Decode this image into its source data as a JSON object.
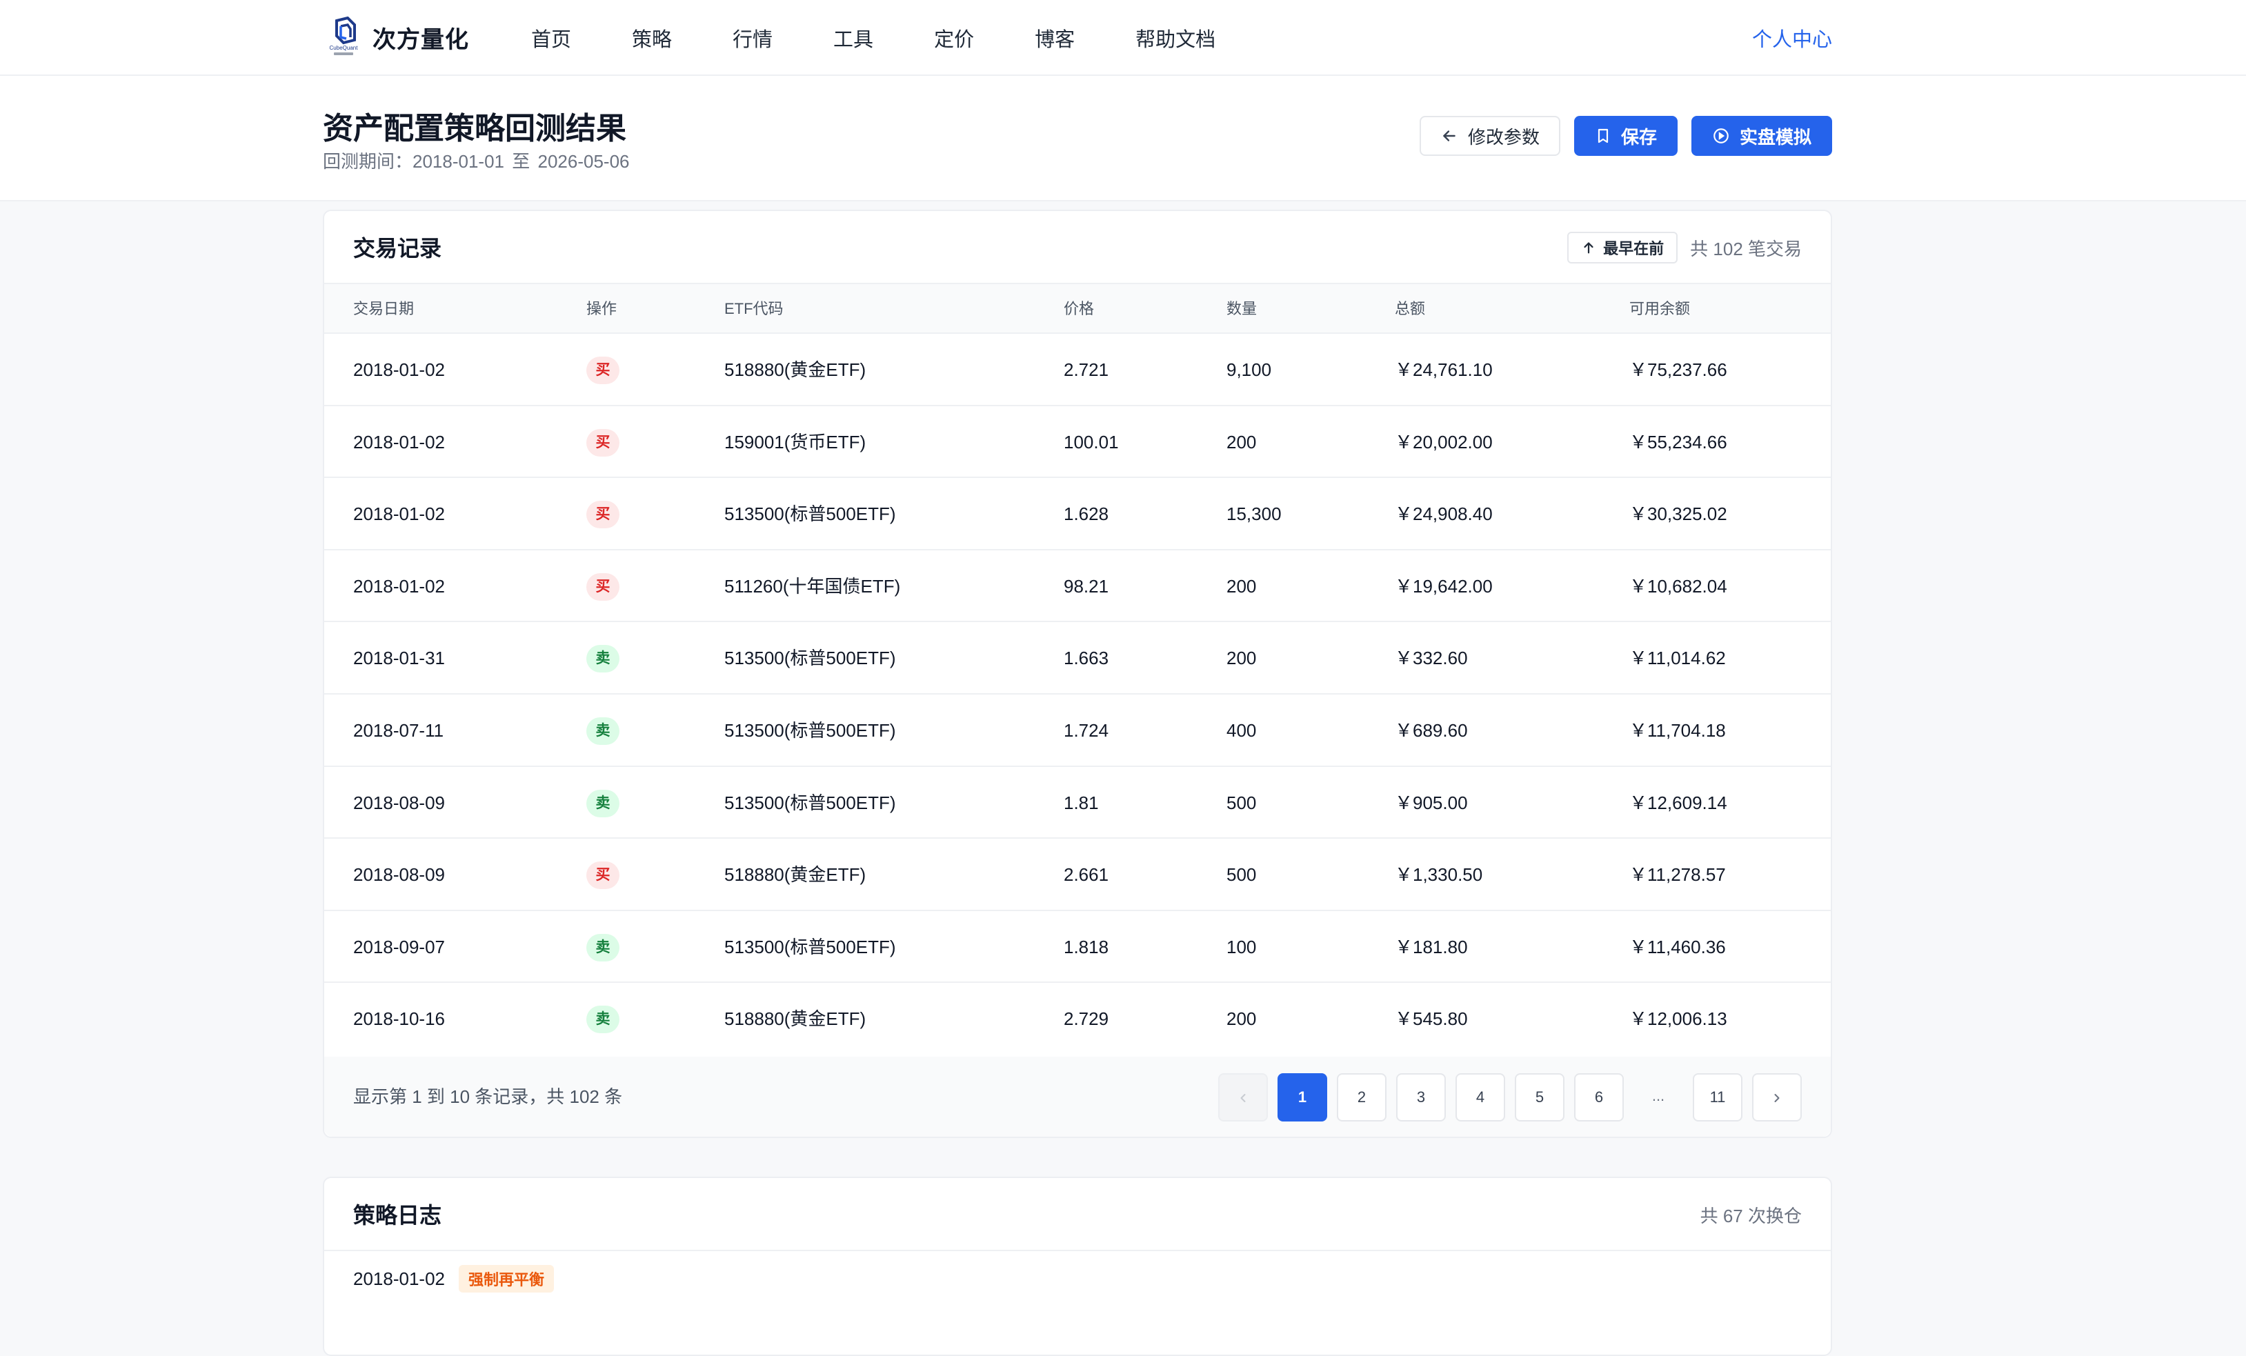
{
  "nav": {
    "brand_name": "次方量化",
    "logo_text": "CubeQuant",
    "items": [
      "首页",
      "策略",
      "行情",
      "工具",
      "定价",
      "博客",
      "帮助文档"
    ],
    "user_center": "个人中心"
  },
  "header": {
    "title": "资产配置策略回测结果",
    "period_label": "回测期间：",
    "period_start": "2018-01-01",
    "period_sep": "至",
    "period_end": "2026-05-06",
    "actions": {
      "edit_params": "修改参数",
      "save": "保存",
      "live_sim": "实盘模拟"
    }
  },
  "trades": {
    "title": "交易记录",
    "sort_label": "最早在前",
    "total_text": "共 102 笔交易",
    "columns": [
      "交易日期",
      "操作",
      "ETF代码",
      "价格",
      "数量",
      "总额",
      "可用余额"
    ],
    "rows": [
      {
        "date": "2018-01-02",
        "op": "买",
        "side": "buy",
        "etf": "518880(黄金ETF)",
        "price": "2.721",
        "qty": "9,100",
        "amount": "￥24,761.10",
        "balance": "￥75,237.66"
      },
      {
        "date": "2018-01-02",
        "op": "买",
        "side": "buy",
        "etf": "159001(货币ETF)",
        "price": "100.01",
        "qty": "200",
        "amount": "￥20,002.00",
        "balance": "￥55,234.66"
      },
      {
        "date": "2018-01-02",
        "op": "买",
        "side": "buy",
        "etf": "513500(标普500ETF)",
        "price": "1.628",
        "qty": "15,300",
        "amount": "￥24,908.40",
        "balance": "￥30,325.02"
      },
      {
        "date": "2018-01-02",
        "op": "买",
        "side": "buy",
        "etf": "511260(十年国债ETF)",
        "price": "98.21",
        "qty": "200",
        "amount": "￥19,642.00",
        "balance": "￥10,682.04"
      },
      {
        "date": "2018-01-31",
        "op": "卖",
        "side": "sell",
        "etf": "513500(标普500ETF)",
        "price": "1.663",
        "qty": "200",
        "amount": "￥332.60",
        "balance": "￥11,014.62"
      },
      {
        "date": "2018-07-11",
        "op": "卖",
        "side": "sell",
        "etf": "513500(标普500ETF)",
        "price": "1.724",
        "qty": "400",
        "amount": "￥689.60",
        "balance": "￥11,704.18"
      },
      {
        "date": "2018-08-09",
        "op": "卖",
        "side": "sell",
        "etf": "513500(标普500ETF)",
        "price": "1.81",
        "qty": "500",
        "amount": "￥905.00",
        "balance": "￥12,609.14"
      },
      {
        "date": "2018-08-09",
        "op": "买",
        "side": "buy",
        "etf": "518880(黄金ETF)",
        "price": "2.661",
        "qty": "500",
        "amount": "￥1,330.50",
        "balance": "￥11,278.57"
      },
      {
        "date": "2018-09-07",
        "op": "卖",
        "side": "sell",
        "etf": "513500(标普500ETF)",
        "price": "1.818",
        "qty": "100",
        "amount": "￥181.80",
        "balance": "￥11,460.36"
      },
      {
        "date": "2018-10-16",
        "op": "卖",
        "side": "sell",
        "etf": "518880(黄金ETF)",
        "price": "2.729",
        "qty": "200",
        "amount": "￥545.80",
        "balance": "￥12,006.13"
      }
    ],
    "footer_text": "显示第 1 到 10 条记录，共 102 条",
    "pages": [
      "1",
      "2",
      "3",
      "4",
      "5",
      "6",
      "...",
      "11"
    ],
    "current_page": "1"
  },
  "log": {
    "title": "策略日志",
    "total_text": "共 67 次换仓",
    "first_date": "2018-01-02",
    "first_tag": "强制再平衡"
  },
  "colors": {
    "accent": "#2563eb",
    "buy_bg": "#fde8e8",
    "buy_text": "#dc2626",
    "sell_bg": "#dcfce7",
    "sell_text": "#15803d",
    "tag_bg": "#fff1e0",
    "tag_text": "#ea580c"
  },
  "icons": {
    "logo": "cube-logo-icon",
    "back": "arrow-left-icon",
    "save": "bookmark-icon",
    "sim": "play-circle-icon",
    "sort": "arrow-up-icon",
    "prev": "chevron-left-icon",
    "next": "chevron-right-icon"
  }
}
